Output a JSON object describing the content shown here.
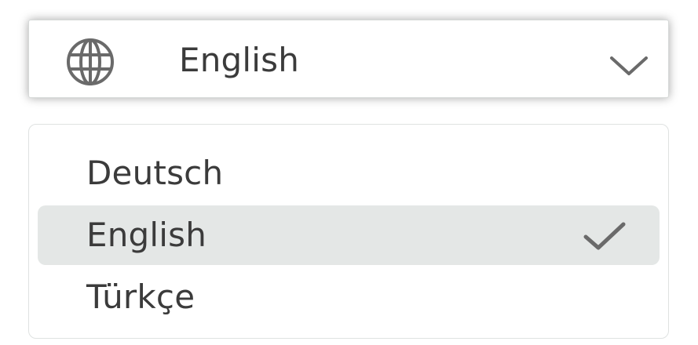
{
  "language_select": {
    "selected_label": "English",
    "icon": "globe-icon",
    "toggle_icon": "chevron-down-icon"
  },
  "menu": {
    "options": [
      {
        "label": "Deutsch",
        "selected": false
      },
      {
        "label": "English",
        "selected": true,
        "icon": "check-icon"
      },
      {
        "label": "Türkçe",
        "selected": false
      }
    ]
  },
  "colors": {
    "text": "#3b3b3b",
    "icon": "#6a6a6a",
    "selected_background": "#e4e7e6",
    "border": "#dfe2e1"
  }
}
